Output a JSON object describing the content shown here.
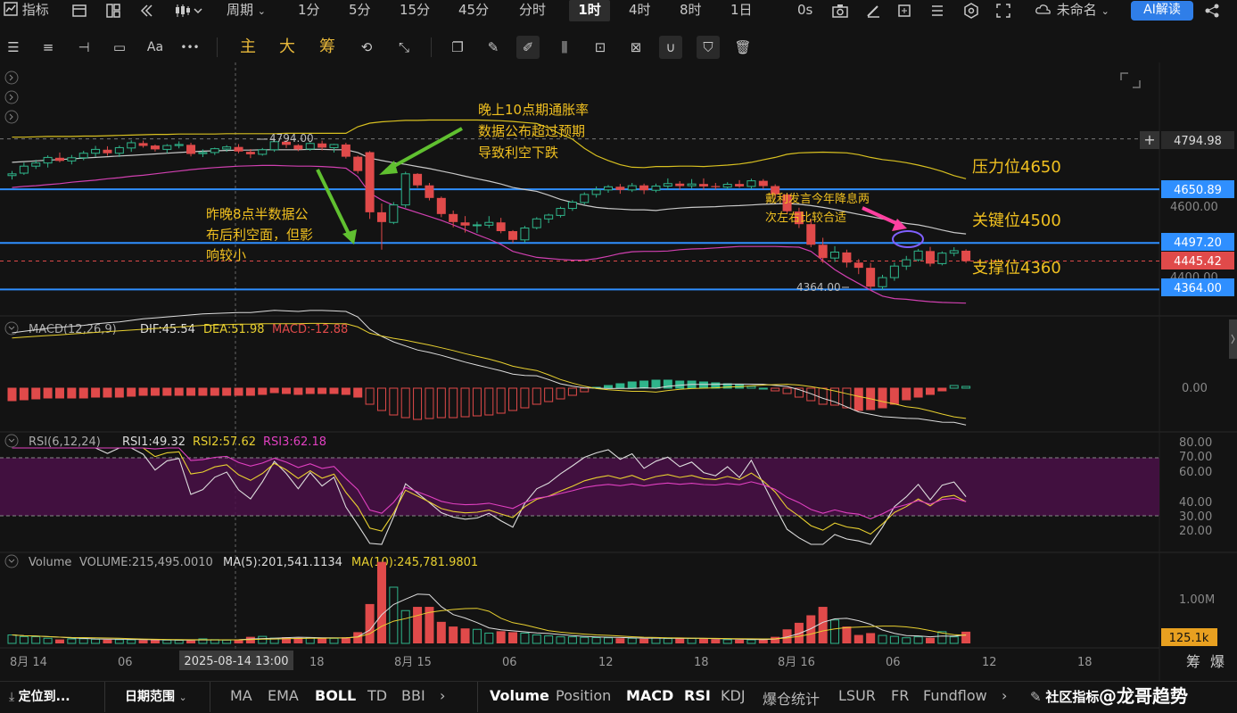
{
  "topbar": {
    "indicators_label": "指标",
    "period_label": "周期",
    "timeframes": [
      "1分",
      "5分",
      "15分",
      "45分",
      "分时",
      "1时",
      "4时",
      "8时",
      "1日"
    ],
    "active_timeframe": "1时",
    "seconds_label": "0s",
    "layout_name": "未命名",
    "ai_button": "AI解读"
  },
  "toolbar": {
    "main_label": "主",
    "big_label": "大",
    "chips_label": "筹",
    "font_label": "Aa",
    "more_label": "•••"
  },
  "price_tags": {
    "high_tag": "4794.98",
    "pressure_tag": "4650.89",
    "axis_4600": "4600.00",
    "key_tag": "4497.20",
    "current_tag": "4445.42",
    "axis_4400": "4400.00",
    "support_tag": "4364.00"
  },
  "annotations": {
    "high_label": "4794.00",
    "low_label": "4364.00",
    "note_cpi_line1": "晚上10点期通胀率",
    "note_cpi_line2": "数据公布超过预期",
    "note_cpi_line3": "导致利空下跌",
    "note_ppi_line1": "昨晚8点半数据公",
    "note_ppi_line2": "布后利空面，但影",
    "note_ppi_line3": "响较小",
    "note_fed_line1": "戴利发言今年降息两",
    "note_fed_line2": "次左右比较合适",
    "pressure_label": "压力位4650",
    "key_label": "关键位4500",
    "support_label": "支撑位4360"
  },
  "macd": {
    "title": "MACD(12,26,9)",
    "dif": "DIF:45.54",
    "dea": "DEA:51.98",
    "macd": "MACD:-12.88",
    "axis_zero": "0.00"
  },
  "rsi": {
    "title": "RSI(6,12,24)",
    "rsi1": "RSI1:49.32",
    "rsi2": "RSI2:57.62",
    "rsi3": "RSI3:62.18",
    "axis": [
      "80.00",
      "70.00",
      "60.00",
      "40.00",
      "30.00",
      "20.00"
    ]
  },
  "volume": {
    "title": "Volume",
    "vol": "VOLUME:215,495.0010",
    "ma5": "MA(5):201,541.1134",
    "ma10": "MA(10):245,781.9801",
    "axis_1m": "1.00M",
    "current_tag": "125.1k"
  },
  "xaxis": {
    "labels": [
      "8月 14",
      "06",
      "18",
      "8月 15",
      "06",
      "12",
      "18",
      "8月 16",
      "06",
      "12",
      "18"
    ],
    "cursor_label": "2025-08-14 13:00",
    "right_label_1": "筹",
    "right_label_2": "爆"
  },
  "bottom": {
    "locate_label": "定位到...",
    "date_range_label": "日期范围",
    "main_indicators": [
      "MA",
      "EMA",
      "BOLL",
      "TD",
      "BBI"
    ],
    "active_main": "BOLL",
    "sub_indicators": [
      "Volume",
      "Position",
      "MACD",
      "RSI",
      "KDJ",
      "爆仓统计",
      "LSUR",
      "FR",
      "Fundflow"
    ],
    "active_sub": [
      "Volume",
      "MACD",
      "RSI"
    ],
    "community_label": "社区指标",
    "watermark": "@龙哥趋势"
  },
  "colors": {
    "up": "#2fb58b",
    "down": "#e04a4a",
    "blue_line": "#2f8fff",
    "boll_upper": "#d8c020",
    "boll_mid": "#c8c8c8",
    "boll_lower": "#d040b0",
    "annotation_yellow": "#f0c020",
    "arrow_green": "#60c030",
    "arrow_pink": "#ff40a0"
  },
  "chart_data": {
    "type": "candlestick",
    "symbol_interval": "1h",
    "time_range": [
      "2025-08-14 00:00",
      "2025-08-16 09:00"
    ],
    "ylim": [
      4320,
      4850
    ],
    "horizontal_levels": [
      4794.98,
      4650.89,
      4497.2,
      4445.42,
      4364.0
    ],
    "candles": [
      [
        4690,
        4703,
        4679,
        4695
      ],
      [
        4697,
        4727,
        4692,
        4717
      ],
      [
        4717,
        4735,
        4709,
        4726
      ],
      [
        4726,
        4748,
        4713,
        4742
      ],
      [
        4741,
        4756,
        4728,
        4732
      ],
      [
        4732,
        4749,
        4722,
        4741
      ],
      [
        4741,
        4761,
        4734,
        4754
      ],
      [
        4754,
        4775,
        4744,
        4765
      ],
      [
        4764,
        4774,
        4747,
        4754
      ],
      [
        4754,
        4776,
        4743,
        4770
      ],
      [
        4769,
        4791,
        4758,
        4784
      ],
      [
        4783,
        4790,
        4770,
        4775
      ],
      [
        4776,
        4779,
        4759,
        4765
      ],
      [
        4765,
        4780,
        4754,
        4776
      ],
      [
        4776,
        4788,
        4768,
        4779
      ],
      [
        4778,
        4784,
        4745,
        4752
      ],
      [
        4753,
        4765,
        4743,
        4756
      ],
      [
        4756,
        4770,
        4749,
        4767
      ],
      [
        4766,
        4777,
        4758,
        4772
      ],
      [
        4772,
        4780,
        4754,
        4759
      ],
      [
        4758,
        4766,
        4740,
        4751
      ],
      [
        4751,
        4769,
        4747,
        4764
      ],
      [
        4764,
        4794,
        4758,
        4787
      ],
      [
        4787,
        4792,
        4769,
        4778
      ],
      [
        4777,
        4780,
        4760,
        4765
      ],
      [
        4766,
        4786,
        4761,
        4782
      ],
      [
        4782,
        4790,
        4762,
        4770
      ],
      [
        4770,
        4781,
        4756,
        4779
      ],
      [
        4779,
        4784,
        4739,
        4744
      ],
      [
        4744,
        4747,
        4696,
        4703
      ],
      [
        4757,
        4760,
        4566,
        4585
      ],
      [
        4585,
        4610,
        4478,
        4557
      ],
      [
        4556,
        4614,
        4551,
        4606
      ],
      [
        4606,
        4701,
        4598,
        4695
      ],
      [
        4695,
        4697,
        4655,
        4662
      ],
      [
        4662,
        4669,
        4619,
        4626
      ],
      [
        4626,
        4630,
        4571,
        4580
      ],
      [
        4580,
        4590,
        4542,
        4557
      ],
      [
        4556,
        4574,
        4527,
        4547
      ],
      [
        4548,
        4558,
        4526,
        4549
      ],
      [
        4548,
        4574,
        4540,
        4556
      ],
      [
        4556,
        4569,
        4525,
        4531
      ],
      [
        4531,
        4534,
        4497,
        4506
      ],
      [
        4506,
        4546,
        4498,
        4540
      ],
      [
        4541,
        4571,
        4536,
        4566
      ],
      [
        4566,
        4581,
        4554,
        4577
      ],
      [
        4576,
        4601,
        4570,
        4596
      ],
      [
        4596,
        4620,
        4589,
        4614
      ],
      [
        4613,
        4642,
        4607,
        4636
      ],
      [
        4636,
        4659,
        4627,
        4649
      ],
      [
        4649,
        4663,
        4641,
        4658
      ],
      [
        4658,
        4666,
        4638,
        4649
      ],
      [
        4649,
        4669,
        4643,
        4661
      ],
      [
        4662,
        4667,
        4637,
        4648
      ],
      [
        4648,
        4667,
        4642,
        4660
      ],
      [
        4660,
        4682,
        4649,
        4667
      ],
      [
        4667,
        4674,
        4649,
        4660
      ],
      [
        4661,
        4680,
        4653,
        4666
      ],
      [
        4666,
        4682,
        4649,
        4659
      ],
      [
        4660,
        4669,
        4650,
        4657
      ],
      [
        4657,
        4671,
        4650,
        4665
      ],
      [
        4666,
        4677,
        4655,
        4659
      ],
      [
        4659,
        4681,
        4651,
        4675
      ],
      [
        4675,
        4680,
        4652,
        4660
      ],
      [
        4660,
        4665,
        4623,
        4636
      ],
      [
        4636,
        4640,
        4580,
        4588
      ],
      [
        4587,
        4598,
        4540,
        4551
      ],
      [
        4551,
        4566,
        4485,
        4492
      ],
      [
        4492,
        4512,
        4440,
        4454
      ],
      [
        4454,
        4488,
        4443,
        4471
      ],
      [
        4470,
        4478,
        4427,
        4441
      ],
      [
        4441,
        4451,
        4408,
        4426
      ],
      [
        4426,
        4440,
        4364,
        4372
      ],
      [
        4372,
        4406,
        4362,
        4398
      ],
      [
        4398,
        4441,
        4389,
        4431
      ],
      [
        4431,
        4460,
        4420,
        4449
      ],
      [
        4449,
        4480,
        4444,
        4474
      ],
      [
        4474,
        4486,
        4430,
        4438
      ],
      [
        4438,
        4473,
        4433,
        4468
      ],
      [
        4468,
        4485,
        4459,
        4475
      ],
      [
        4475,
        4479,
        4440,
        4445
      ]
    ],
    "boll_upper": [
      4800,
      4800,
      4801,
      4802,
      4802,
      4802,
      4803,
      4803,
      4804,
      4805,
      4806,
      4807,
      4808,
      4808,
      4809,
      4809,
      4809,
      4809,
      4810,
      4810,
      4810,
      4810,
      4810,
      4811,
      4811,
      4811,
      4811,
      4811,
      4811,
      4830,
      4840,
      4844,
      4846,
      4848,
      4848,
      4849,
      4849,
      4849,
      4849,
      4849,
      4848,
      4847,
      4845,
      4842,
      4839,
      4826,
      4809,
      4794,
      4768,
      4747,
      4733,
      4721,
      4714,
      4713,
      4716,
      4716,
      4717,
      4717,
      4716,
      4718,
      4720,
      4723,
      4728,
      4735,
      4742,
      4751,
      4755,
      4756,
      4757,
      4756,
      4755,
      4750,
      4742,
      4736,
      4732,
      4727,
      4720,
      4712,
      4702,
      4690,
      4681
    ],
    "boll_mid": [
      4728,
      4730,
      4732,
      4734,
      4736,
      4738,
      4740,
      4742,
      4744,
      4746,
      4748,
      4750,
      4752,
      4754,
      4756,
      4758,
      4760,
      4761,
      4762,
      4763,
      4763,
      4764,
      4764,
      4764,
      4764,
      4765,
      4765,
      4764,
      4764,
      4756,
      4740,
      4733,
      4727,
      4722,
      4716,
      4710,
      4703,
      4696,
      4688,
      4681,
      4674,
      4666,
      4656,
      4650,
      4645,
      4634,
      4622,
      4613,
      4605,
      4599,
      4596,
      4594,
      4592,
      4592,
      4590,
      4594,
      4597,
      4599,
      4600,
      4601,
      4603,
      4604,
      4606,
      4608,
      4609,
      4610,
      4608,
      4604,
      4599,
      4593,
      4586,
      4579,
      4573,
      4566,
      4560,
      4553,
      4549,
      4542,
      4534,
      4527,
      4523
    ],
    "boll_lower": [
      4656,
      4659,
      4661,
      4664,
      4667,
      4671,
      4674,
      4677,
      4681,
      4684,
      4688,
      4691,
      4695,
      4699,
      4703,
      4707,
      4710,
      4713,
      4715,
      4717,
      4718,
      4719,
      4719,
      4718,
      4717,
      4717,
      4716,
      4714,
      4711,
      4687,
      4640,
      4620,
      4605,
      4595,
      4584,
      4573,
      4562,
      4549,
      4535,
      4521,
      4508,
      4493,
      4473,
      4464,
      4456,
      4453,
      4450,
      4448,
      4448,
      4452,
      4459,
      4467,
      4472,
      4473,
      4473,
      4474,
      4478,
      4480,
      4481,
      4483,
      4485,
      4487,
      4487,
      4487,
      4487,
      4486,
      4485,
      4473,
      4447,
      4421,
      4400,
      4381,
      4362,
      4345,
      4338,
      4336,
      4332,
      4329,
      4327,
      4326,
      4325
    ],
    "volume": [
      90000,
      73000,
      72000,
      55000,
      42000,
      48000,
      50000,
      45000,
      40000,
      40000,
      38000,
      36000,
      41000,
      35000,
      33000,
      32000,
      48000,
      40000,
      35000,
      39000,
      70000,
      75000,
      56000,
      66000,
      60000,
      58000,
      55000,
      54000,
      65000,
      120000,
      420000,
      870000,
      600000,
      350000,
      390000,
      390000,
      230000,
      180000,
      160000,
      150000,
      110000,
      130000,
      120000,
      110000,
      90000,
      80000,
      70000,
      70000,
      65000,
      62000,
      60000,
      55000,
      55000,
      50000,
      60000,
      52000,
      52000,
      54000,
      50000,
      45000,
      40000,
      40000,
      38000,
      44000,
      70000,
      150000,
      220000,
      300000,
      390000,
      250000,
      180000,
      90000,
      110000,
      85000,
      75000,
      60000,
      70000,
      60000,
      125000,
      70000,
      125100
    ],
    "macd_hist": [
      -14,
      -13,
      -12,
      -11,
      -11,
      -11,
      -11,
      -10,
      -10,
      -10,
      -9,
      -8,
      -8,
      -8,
      -8,
      -8,
      -8,
      -8,
      -8,
      -8,
      -8,
      -7,
      -5,
      -6,
      -7,
      -6,
      -6,
      -6,
      -7,
      -10,
      -18,
      -25,
      -30,
      -33,
      -35,
      -34,
      -33,
      -33,
      -32,
      -31,
      -30,
      -28,
      -25,
      -22,
      -18,
      -15,
      -12,
      -8,
      -4,
      1,
      3,
      5,
      7,
      8,
      9,
      9,
      8,
      8,
      7,
      6,
      5,
      4,
      2,
      0,
      -3,
      -6,
      -10,
      -14,
      -18,
      -19,
      -22,
      -25,
      -24,
      -22,
      -18,
      -13,
      -10,
      -7,
      -3,
      3,
      2
    ]
  }
}
